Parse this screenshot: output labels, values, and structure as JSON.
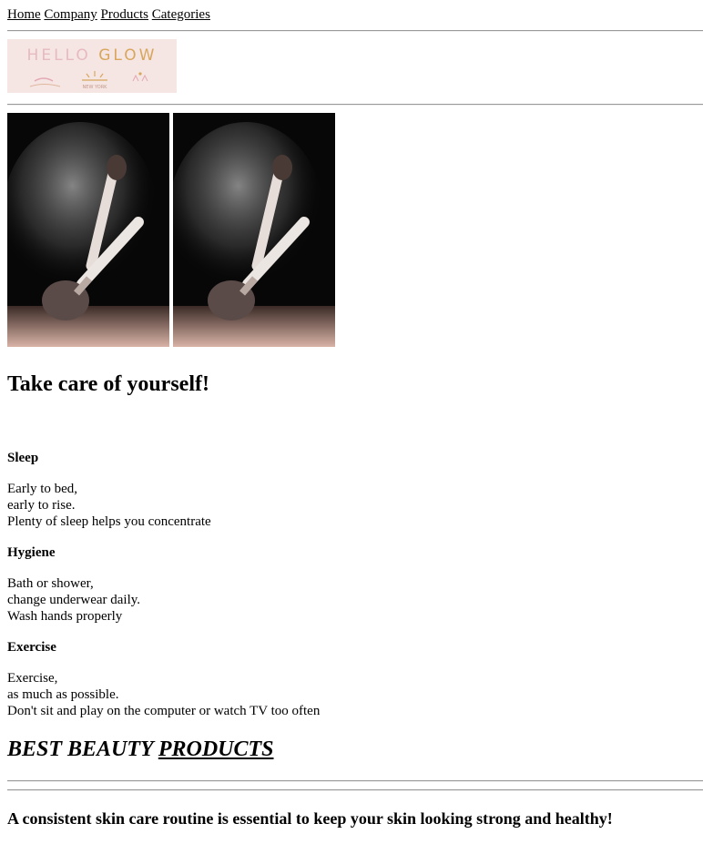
{
  "nav": {
    "links": [
      "Home",
      "Company",
      "Products",
      "Categories"
    ]
  },
  "logo": {
    "title_part1": "HELLO ",
    "title_part2": "GLOW"
  },
  "hero": {
    "photo_description_icon": "makeup-brushes-powder-photo",
    "colors": {
      "background": "#070707",
      "powder": "#d9b3a6"
    }
  },
  "headline": "Take care of yourself!",
  "sections": [
    {
      "title": "Sleep",
      "lines": [
        "Early to bed,",
        "early to rise.",
        "Plenty of sleep helps you concentrate"
      ]
    },
    {
      "title": "Hygiene",
      "lines": [
        "Bath or shower,",
        "change underwear daily.",
        "Wash hands properly"
      ]
    },
    {
      "title": "Exercise",
      "lines": [
        "Exercise,",
        "as much as possible.",
        "Don't sit and play on the computer or watch TV too often"
      ]
    }
  ],
  "products_heading": {
    "part1": "BEST BEAUTY ",
    "part2": "PRODUCTS"
  },
  "tagline": "A consistent skin care routine is essential to keep your skin looking strong and healthy!"
}
